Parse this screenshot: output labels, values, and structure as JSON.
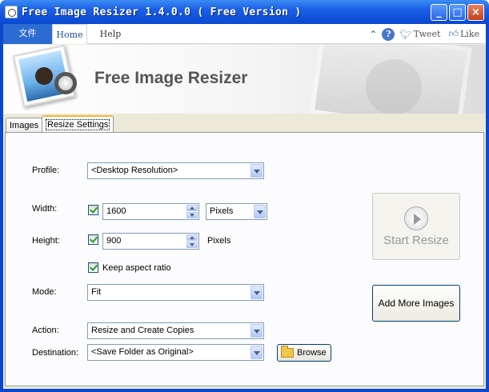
{
  "window": {
    "title": "Free Image Resizer 1.4.0.0 ( Free Version )"
  },
  "ribbon": {
    "file_tab": "文件",
    "tabs": [
      {
        "label": "Home"
      },
      {
        "label": "Help"
      }
    ],
    "tweet": "Tweet",
    "like": "Like",
    "help_glyph": "?"
  },
  "banner": {
    "title": "Free Image Resizer"
  },
  "content_tabs": [
    {
      "label": "Images"
    },
    {
      "label": "Resize Settings"
    }
  ],
  "form": {
    "profile_label": "Profile:",
    "profile_value": "<Desktop Resolution>",
    "width_label": "Width:",
    "width_value": "1600",
    "width_unit": "Pixels",
    "height_label": "Height:",
    "height_value": "900",
    "height_unit": "Pixels",
    "keep_aspect": "Keep aspect ratio",
    "mode_label": "Mode:",
    "mode_value": "Fit",
    "action_label": "Action:",
    "action_value": "Resize and Create Copies",
    "destination_label": "Destination:",
    "destination_value": "<Save Folder as Original>",
    "browse_label": "Browse"
  },
  "buttons": {
    "start_resize": "Start Resize",
    "add_more_images": "Add More Images"
  }
}
